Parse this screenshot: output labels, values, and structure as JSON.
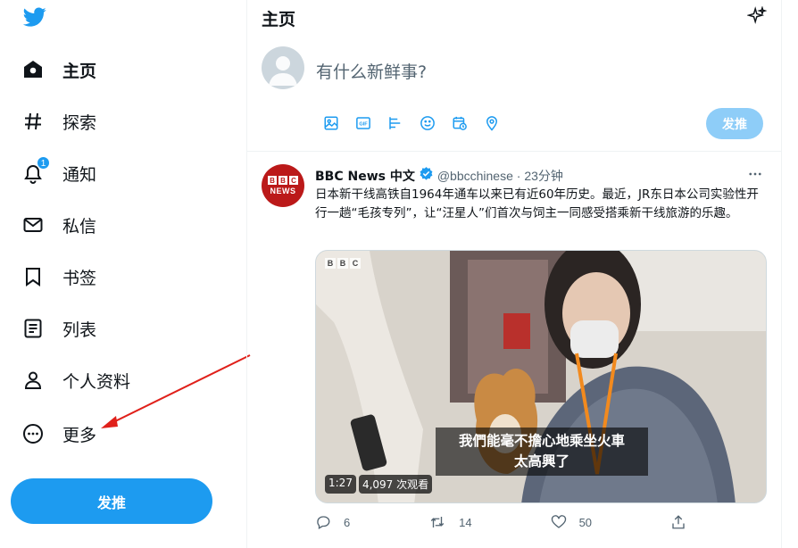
{
  "sidebar": {
    "items": [
      {
        "label": "主页",
        "icon": "home-icon",
        "active": true
      },
      {
        "label": "探索",
        "icon": "hashtag-icon"
      },
      {
        "label": "通知",
        "icon": "bell-icon",
        "badge": "1"
      },
      {
        "label": "私信",
        "icon": "mail-icon"
      },
      {
        "label": "书签",
        "icon": "bookmark-icon"
      },
      {
        "label": "列表",
        "icon": "list-icon"
      },
      {
        "label": "个人资料",
        "icon": "person-icon"
      },
      {
        "label": "更多",
        "icon": "more-circle-icon"
      }
    ],
    "tweet_button": "发推"
  },
  "header": {
    "title": "主页"
  },
  "compose": {
    "placeholder": "有什么新鲜事?",
    "send_label": "发推",
    "tools": [
      "image-icon",
      "gif-icon",
      "poll-icon",
      "emoji-icon",
      "schedule-icon",
      "location-icon"
    ]
  },
  "tweet": {
    "name": "BBC News 中文",
    "handle": "@bbcchinese · 23分钟",
    "text": "日本新干线高铁自1964年通车以来已有近60年历史。最近，JR东日本公司实验性开行一趟“毛孩专列”，让“汪星人”们首次与饲主一同感受搭乘新干线旅游的乐趣。",
    "avatar_text": "NEWS",
    "media": {
      "watermark": [
        "B",
        "B",
        "C"
      ],
      "subtitle_line1": "我們能毫不擔心地乘坐火車",
      "subtitle_line2": "太高興了",
      "duration": "1:27",
      "views": "4,097 次观看"
    },
    "actions": {
      "replies": "6",
      "retweets": "14",
      "likes": "50"
    }
  },
  "colors": {
    "accent": "#1d9bf0",
    "accent_disabled": "#8ecdf8",
    "annotation_arrow": "#e0201a"
  }
}
